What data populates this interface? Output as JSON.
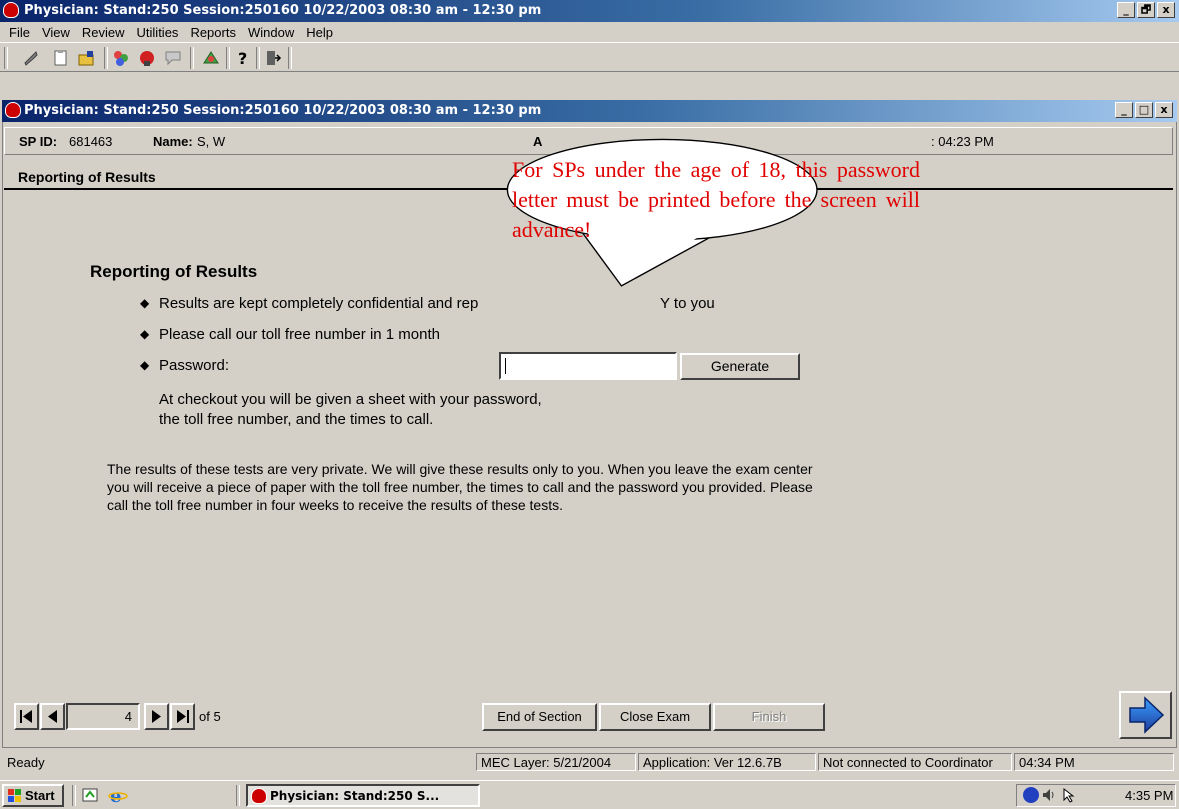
{
  "app": {
    "title": "Physician: Stand:250 Session:250160 10/22/2003 08:30 am - 12:30 pm",
    "window_buttons": {
      "minimize": "_",
      "restore": "🗗",
      "close": "x"
    }
  },
  "menu": [
    "File",
    "View",
    "Review",
    "Utilities",
    "Reports",
    "Window",
    "Help"
  ],
  "toolbar_icons": [
    "wrench-icon",
    "clipboard-icon",
    "open-folder-icon",
    "people-icon",
    "stop-hand-icon",
    "comment-icon",
    "tools-icon",
    "help-icon",
    "exit-door-icon"
  ],
  "inner_window": {
    "title": "Physician: Stand:250 Session:250160 10/22/2003 08:30 am - 12:30 pm"
  },
  "sp": {
    "id_label": "SP ID:",
    "id_value": "681463",
    "name_label": "Name:",
    "name_value": "S, W",
    "partial_a": "A",
    "time_fragment": ": 04:23 PM"
  },
  "section_title": "Reporting of Results",
  "callout": "For SPs under the age of 18, this password letter must be printed before the screen will advance!",
  "content": {
    "heading": "Reporting of Results",
    "bullets": [
      "Results are kept completely confidential and rep",
      "Please call our toll free number in 1 month",
      "Password:"
    ],
    "bullet1_tail": "Y to you",
    "password_value": "",
    "generate_label": "Generate",
    "checkout_line1": "At checkout you will be given a sheet with your password,",
    "checkout_line2": "the toll free number, and the times to call.",
    "para_line1": "The results of these tests are very private.  We will give these results only to you. When you leave the exam center",
    "para_line2": "you will receive a piece of paper with the toll free number, the times to call and the password you provided. Please",
    "para_line3": "call the toll free number in four weeks to receive the results of these tests."
  },
  "navigator": {
    "page": "4",
    "of_label": "of 5"
  },
  "bottom_buttons": {
    "end_of_section": "End of Section",
    "close_exam": "Close Exam",
    "finish": "Finish"
  },
  "status": {
    "ready": "Ready",
    "mec_layer": "MEC Layer: 5/21/2004",
    "application": "Application: Ver 12.6.7B",
    "connection": "Not connected to Coordinator",
    "time": "04:34 PM"
  },
  "taskbar": {
    "start_label": "Start",
    "task_label": "Physician: Stand:250 S...",
    "clock": "4:35 PM"
  },
  "colors": {
    "titlebar": "#0a246a",
    "callout_text": "#e00000",
    "face": "#d4d0c8",
    "next_arrow": "#1e3c9e"
  }
}
